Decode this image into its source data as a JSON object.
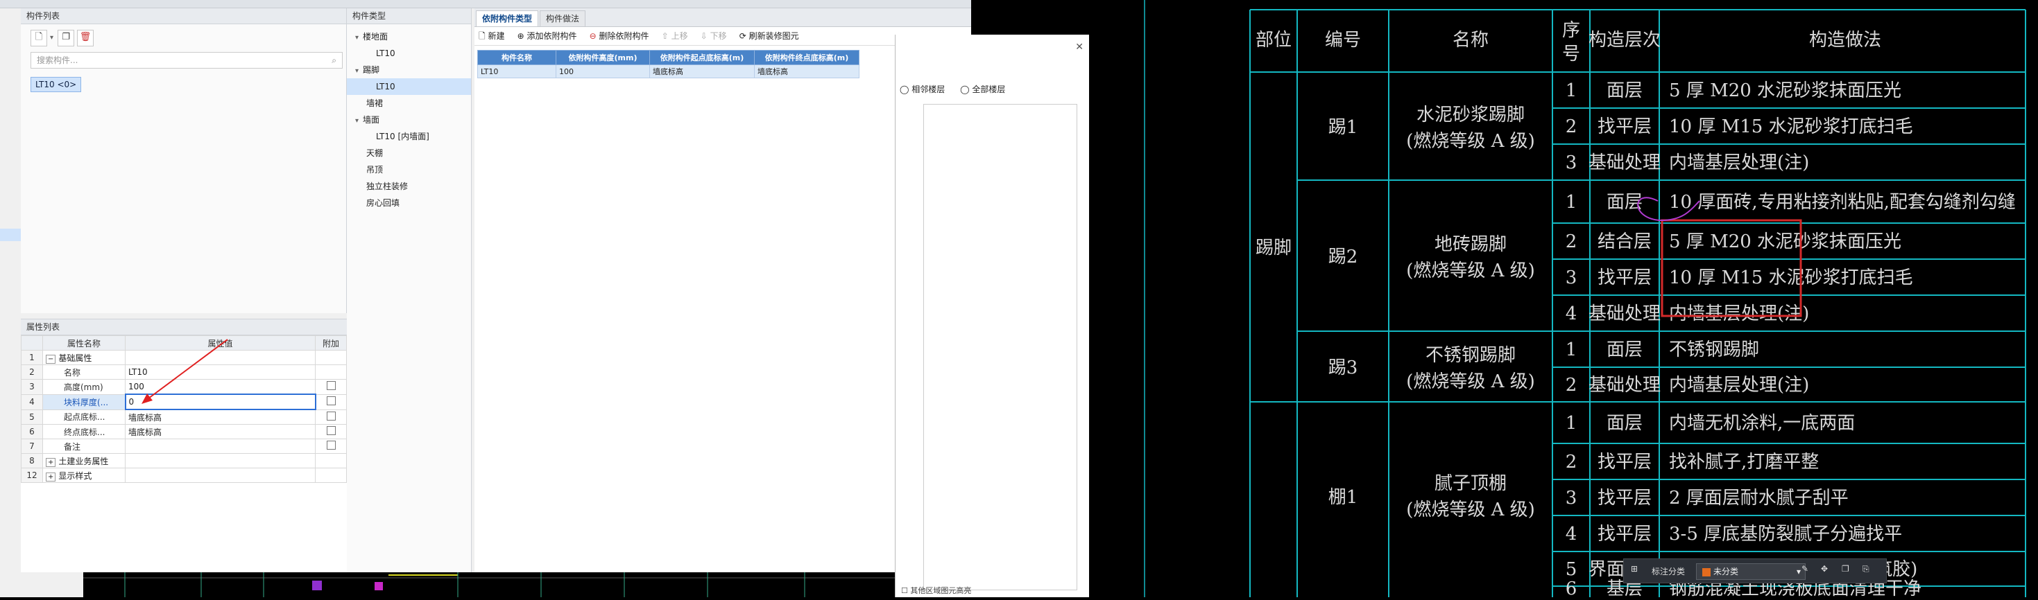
{
  "left_panel": {
    "title": "构件列表",
    "search_placeholder": "搜索构件...",
    "items": [
      "LT10 <0>"
    ]
  },
  "props": {
    "title": "属性列表",
    "headers": [
      "属性名称",
      "属性值",
      "附加"
    ],
    "rows": [
      {
        "n": "1",
        "name": "基础属性",
        "val": "",
        "chk": false,
        "group": true
      },
      {
        "n": "2",
        "name": "名称",
        "val": "LT10",
        "chk": false
      },
      {
        "n": "3",
        "name": "高度(mm)",
        "val": "100",
        "chk": true
      },
      {
        "n": "4",
        "name": "块料厚度(...",
        "val": "0",
        "chk": true,
        "edit": true
      },
      {
        "n": "5",
        "name": "起点底标...",
        "val": "墙底标高",
        "chk": true
      },
      {
        "n": "6",
        "name": "终点底标...",
        "val": "墙底标高",
        "chk": true
      },
      {
        "n": "7",
        "name": "备注",
        "val": "",
        "chk": true
      },
      {
        "n": "8",
        "name": "土建业务属性",
        "val": "",
        "chk": false,
        "group": true
      },
      {
        "n": "12",
        "name": "显示样式",
        "val": "",
        "chk": false,
        "group": true
      }
    ]
  },
  "tree": {
    "title": "构件类型",
    "items": [
      {
        "label": "楼地面",
        "indent": 1,
        "exp": "▾"
      },
      {
        "label": "LT10",
        "indent": 2
      },
      {
        "label": "踢脚",
        "indent": 1,
        "exp": "▾"
      },
      {
        "label": "LT10",
        "indent": 2,
        "selected": true
      },
      {
        "label": "墙裙",
        "indent": 1
      },
      {
        "label": "墙面",
        "indent": 1,
        "exp": "▾"
      },
      {
        "label": "LT10 [内墙面]",
        "indent": 2
      },
      {
        "label": "天棚",
        "indent": 1
      },
      {
        "label": "吊顶",
        "indent": 1
      },
      {
        "label": "独立柱装修",
        "indent": 1
      },
      {
        "label": "房心回填",
        "indent": 1
      }
    ]
  },
  "right": {
    "tabs": [
      "依附构件类型",
      "构件做法"
    ],
    "toolbar": [
      "新建",
      "添加依附构件",
      "删除依附构件",
      "上移",
      "下移",
      "刷新装修图元"
    ],
    "grid_headers": [
      "构件名称",
      "依附构件高度(mm)",
      "依附构件起点底标高(m)",
      "依附构件终点底标高(m)"
    ],
    "grid_rows": [
      [
        "LT10",
        "100",
        "墙底标高",
        "墙底标高"
      ]
    ]
  },
  "dialog": {
    "opt1": "相邻楼层",
    "opt2": "全部楼层",
    "bottom": "其他区域图元高亮"
  },
  "floatbar": {
    "label": "标注分类",
    "value": "未分类"
  },
  "cad_table": {
    "headers": [
      "部位",
      "编号",
      "名称",
      "序号",
      "构造层次",
      "构造做法"
    ],
    "group1": "踢脚",
    "group2_code": "棚1",
    "codes": [
      "踢1",
      "踢2",
      "踢3"
    ],
    "names": [
      [
        "水泥砂浆踢脚",
        "(燃烧等级  A 级)"
      ],
      [
        "地砖踢脚",
        "(燃烧等级  A 级)"
      ],
      [
        "不锈钢踢脚",
        "(燃烧等级  A 级)"
      ],
      [
        "腻子顶棚",
        "(燃烧等级  A 级)"
      ]
    ],
    "rows": [
      [
        "1",
        "面层",
        "5 厚 M20  水泥砂浆抹面压光"
      ],
      [
        "2",
        "找平层",
        "10  厚 M15  水泥砂浆打底扫毛"
      ],
      [
        "3",
        "基础处理",
        "内墙基层处理(注)"
      ],
      [
        "1",
        "面层",
        "10  厚面砖,专用粘接剂粘贴,配套勾缝剂勾缝"
      ],
      [
        "2",
        "结合层",
        "5 厚 M20  水泥砂浆抹面压光"
      ],
      [
        "3",
        "找平层",
        "10  厚 M15  水泥砂浆打底扫毛"
      ],
      [
        "4",
        "基础处理",
        "内墙基层处理(注)"
      ],
      [
        "1",
        "面层",
        "不锈钢踢脚"
      ],
      [
        "2",
        "基础处理",
        "内墙基层处理(注)"
      ],
      [
        "1",
        "面层",
        "内墙无机涂料,一底两面"
      ],
      [
        "2",
        "找平层",
        "找补腻子,打磨平整"
      ],
      [
        "3",
        "找平层",
        "2 厚面层耐水腻子刮平"
      ],
      [
        "4",
        "找平层",
        "3-5  厚底基防裂腻子分遍找平"
      ],
      [
        "5",
        "界面处理",
        "素水泥浆一道甩毛(内掺建筑胶)"
      ],
      [
        "6",
        "基层",
        "钢筋混凝土现浇板底面清理干净"
      ]
    ]
  },
  "colors": {
    "cad_line": "#14b8c2",
    "highlight": "#d32a2a",
    "selection": "#cfe3fb",
    "grid_header": "#4a84c9"
  }
}
